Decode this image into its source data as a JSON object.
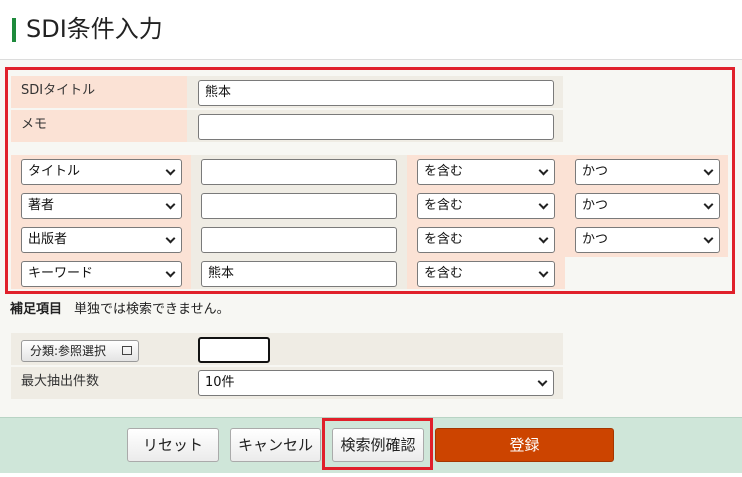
{
  "header": {
    "title": "SDI条件入力"
  },
  "fields": {
    "sdi_title": {
      "label": "SDIタイトル",
      "value": "熊本"
    },
    "memo": {
      "label": "メモ",
      "value": ""
    }
  },
  "criteria": [
    {
      "field": "タイトル",
      "value": "",
      "match": "を含む",
      "op": "かつ"
    },
    {
      "field": "著者",
      "value": "",
      "match": "を含む",
      "op": "かつ"
    },
    {
      "field": "出版者",
      "value": "",
      "match": "を含む",
      "op": "かつ"
    },
    {
      "field": "キーワード",
      "value": "熊本",
      "match": "を含む"
    }
  ],
  "supplement": {
    "label": "補足項目",
    "note": "単独では検索できません。",
    "classification_button": "分類:参照選択",
    "classification_value": "",
    "max_results_label": "最大抽出件数",
    "max_results_value": "10件"
  },
  "buttons": {
    "reset": "リセット",
    "cancel": "キャンセル",
    "search_example": "検索例確認",
    "register": "登録"
  },
  "colors": {
    "accent": "#1e8a3c",
    "highlight": "#e0202a",
    "primary": "#cc4400",
    "label_bg": "#fbe2d5"
  }
}
